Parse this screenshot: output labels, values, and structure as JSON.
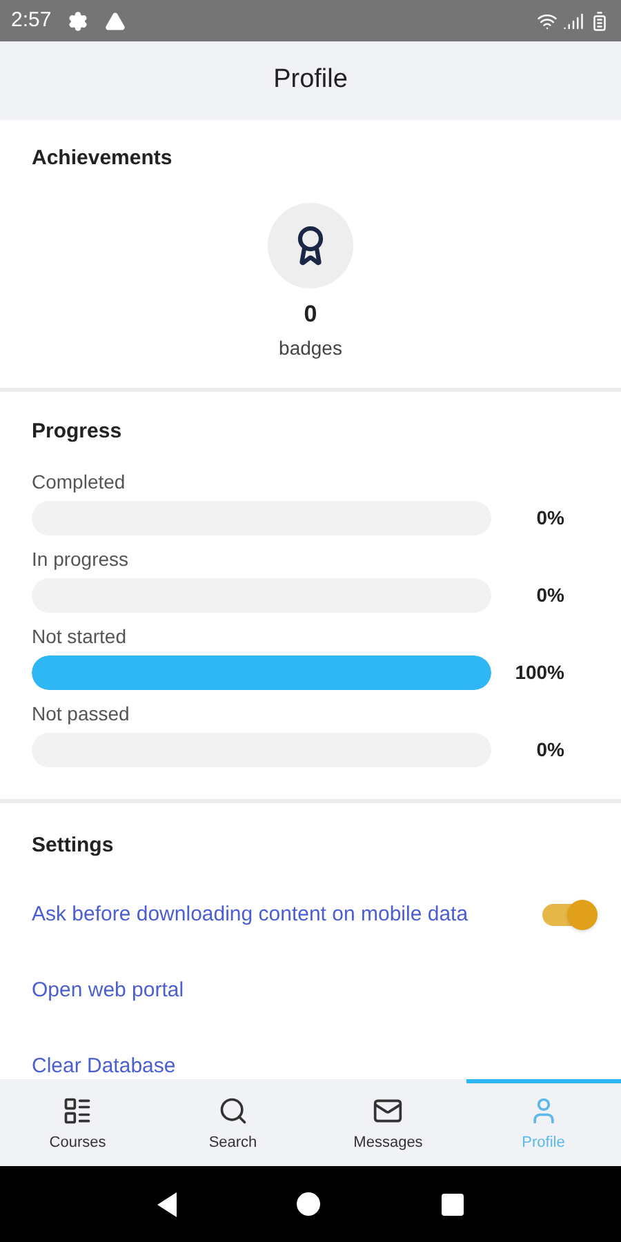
{
  "status_bar": {
    "time": "2:57"
  },
  "header": {
    "title": "Profile"
  },
  "achievements": {
    "title": "Achievements",
    "count": "0",
    "unit": "badges"
  },
  "progress": {
    "title": "Progress",
    "items": [
      {
        "label": "Completed",
        "level": 0,
        "reading": "0%"
      },
      {
        "label": "In progress",
        "level": 0,
        "reading": "0%"
      },
      {
        "label": "Not started",
        "level": 1,
        "reading": "100%"
      },
      {
        "label": "Not passed",
        "level": 0,
        "reading": "0%"
      }
    ]
  },
  "settings": {
    "title": "Settings",
    "items": [
      {
        "kind": "toggle",
        "label": "Ask before downloading content on mobile data",
        "on": true
      },
      {
        "kind": "link",
        "label": "Open web portal"
      },
      {
        "kind": "link",
        "label": "Clear Database"
      }
    ]
  },
  "tabs": [
    {
      "label": "Courses",
      "selected": false
    },
    {
      "label": "Search",
      "selected": false
    },
    {
      "label": "Messages",
      "selected": false
    },
    {
      "label": "Profile",
      "selected": true
    }
  ]
}
